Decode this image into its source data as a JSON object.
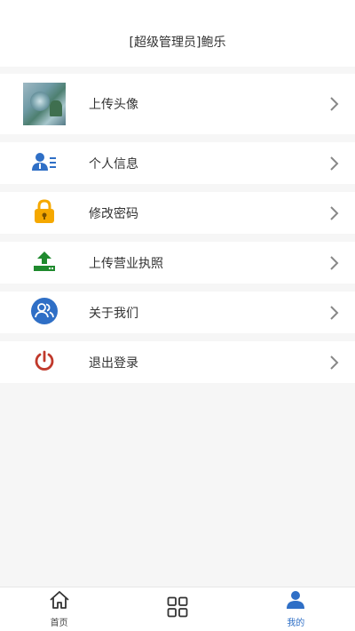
{
  "header": {
    "title": "[超级管理员]鲍乐"
  },
  "menu": [
    {
      "label": "上传头像",
      "icon": "avatar-photo"
    },
    {
      "label": "个人信息",
      "icon": "user-info-icon"
    },
    {
      "label": "修改密码",
      "icon": "lock-icon"
    },
    {
      "label": "上传营业执照",
      "icon": "upload-icon"
    },
    {
      "label": "关于我们",
      "icon": "group-icon"
    },
    {
      "label": "退出登录",
      "icon": "power-icon"
    }
  ],
  "tabbar": {
    "tabs": [
      {
        "label": "首页",
        "icon": "home-icon"
      },
      {
        "label": "",
        "icon": "grid-icon"
      },
      {
        "label": "我的",
        "icon": "person-icon"
      }
    ],
    "active_index": 2
  },
  "colors": {
    "accent": "#2f6fc6",
    "lock": "#f5a800",
    "upload": "#1f8a2e",
    "power": "#c0392b",
    "chevron": "#888888"
  }
}
